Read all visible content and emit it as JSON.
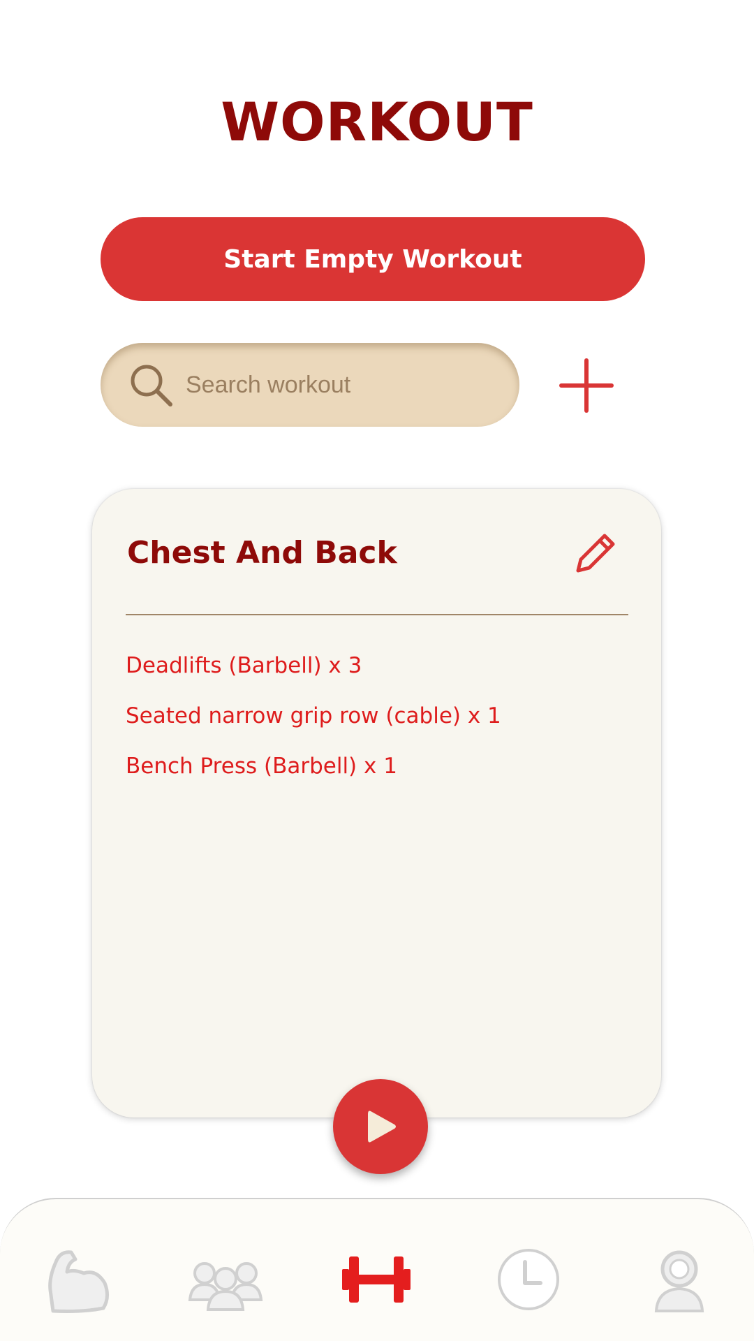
{
  "header": {
    "title": "WORKOUT"
  },
  "actions": {
    "start_label": "Start Empty Workout"
  },
  "search": {
    "placeholder": "Search workout",
    "value": ""
  },
  "routine": {
    "title": "Chest And Back",
    "exercises": [
      {
        "label": "Deadlifts (Barbell) x 3"
      },
      {
        "label": "Seated narrow grip row (cable) x 1"
      },
      {
        "label": "Bench Press (Barbell) x 1"
      }
    ]
  },
  "nav": {
    "items": [
      {
        "icon": "muscle-arm-icon",
        "active": false
      },
      {
        "icon": "people-group-icon",
        "active": false
      },
      {
        "icon": "dumbbell-icon",
        "active": true
      },
      {
        "icon": "clock-history-icon",
        "active": false
      },
      {
        "icon": "profile-icon",
        "active": false
      }
    ]
  },
  "colors": {
    "primary": "#da3534",
    "title": "#8e0a08",
    "search_bg": "#ebd8bb",
    "card_bg": "#f8f6ef",
    "exercise_text": "#de1c1c",
    "nav_inactive": "#d9d9d9"
  }
}
